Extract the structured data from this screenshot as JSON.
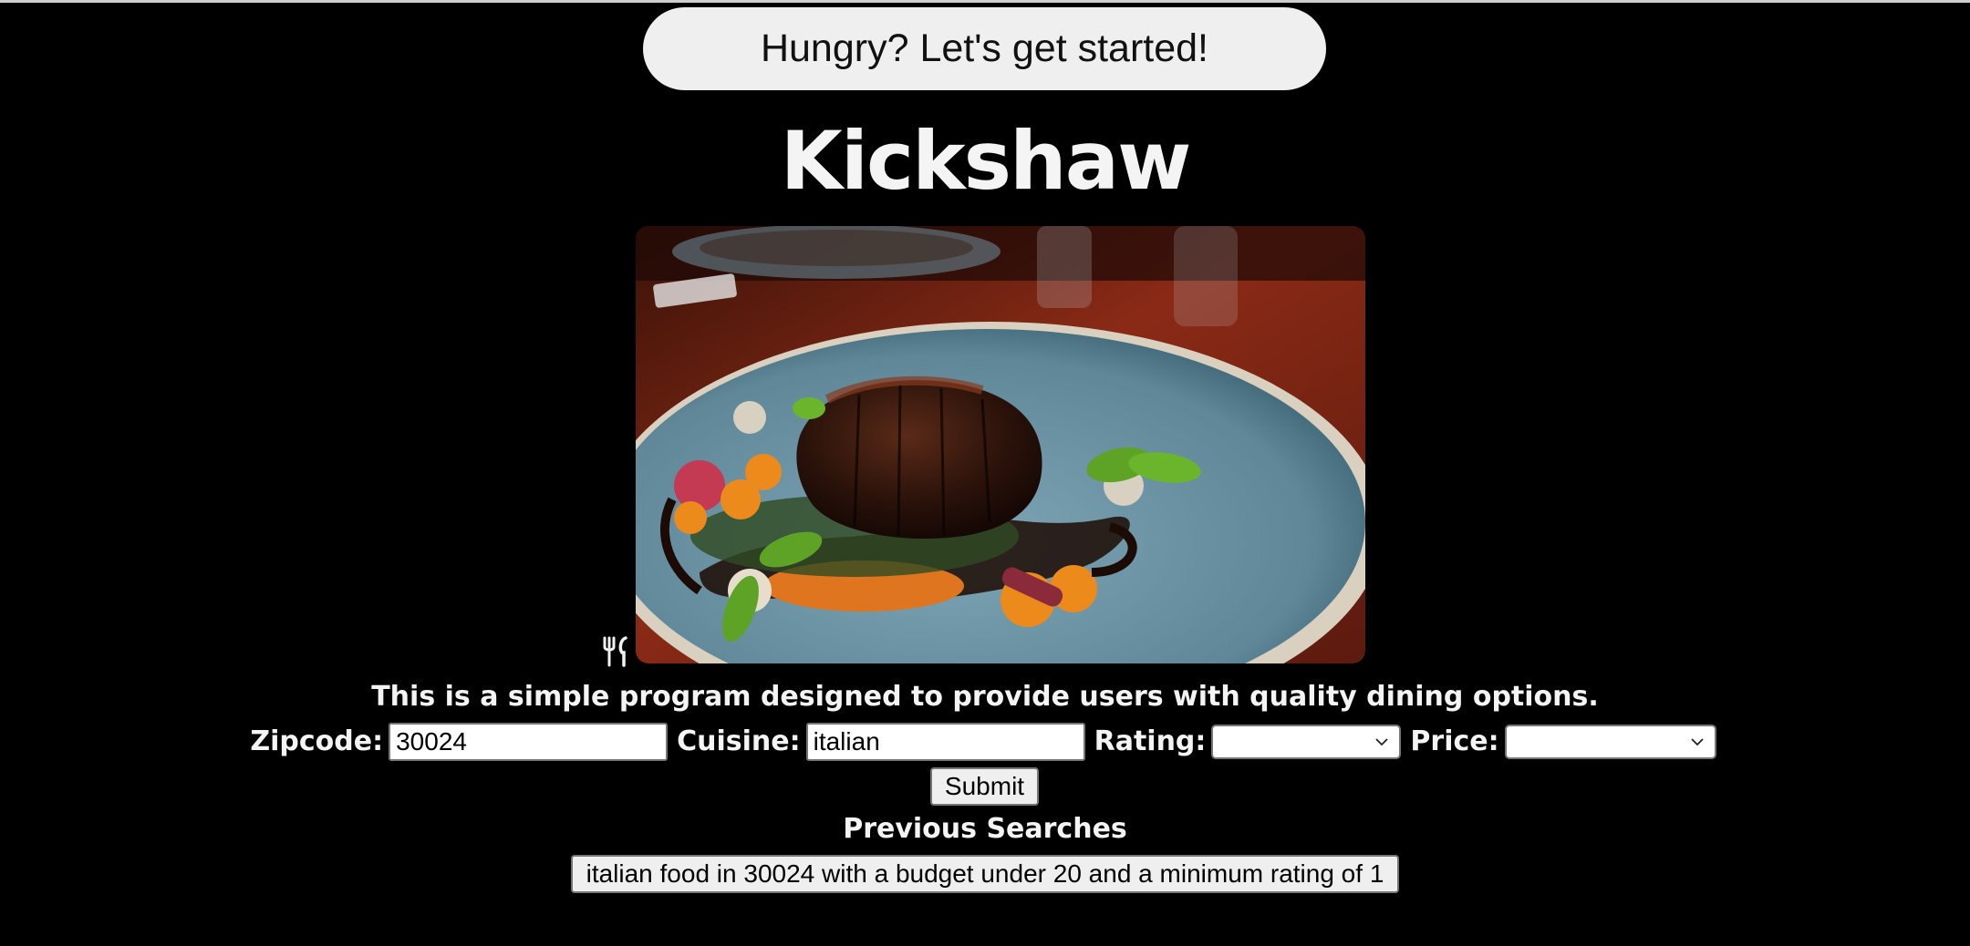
{
  "header": {
    "banner_label": "Hungry? Let's get started!",
    "app_title": "Kickshaw"
  },
  "hero": {
    "photo_icon": "food-photo",
    "fallback_icon": "utensils-icon"
  },
  "intro": {
    "tagline": "This is a simple program designed to provide users with quality dining options."
  },
  "search": {
    "zipcode_label": "Zipcode:",
    "zipcode_value": "30024",
    "cuisine_label": "Cuisine:",
    "cuisine_value": "italian",
    "rating_label": "Rating:",
    "rating_value": "",
    "price_label": "Price:",
    "price_value": "",
    "submit_label": "Submit"
  },
  "history": {
    "heading": "Previous Searches",
    "items": [
      "italian food in 30024 with a budget under 20 and a minimum rating of 1"
    ]
  },
  "colors": {
    "background": "#000000",
    "button_bg": "#efefef",
    "text": "#f4f4f4"
  }
}
